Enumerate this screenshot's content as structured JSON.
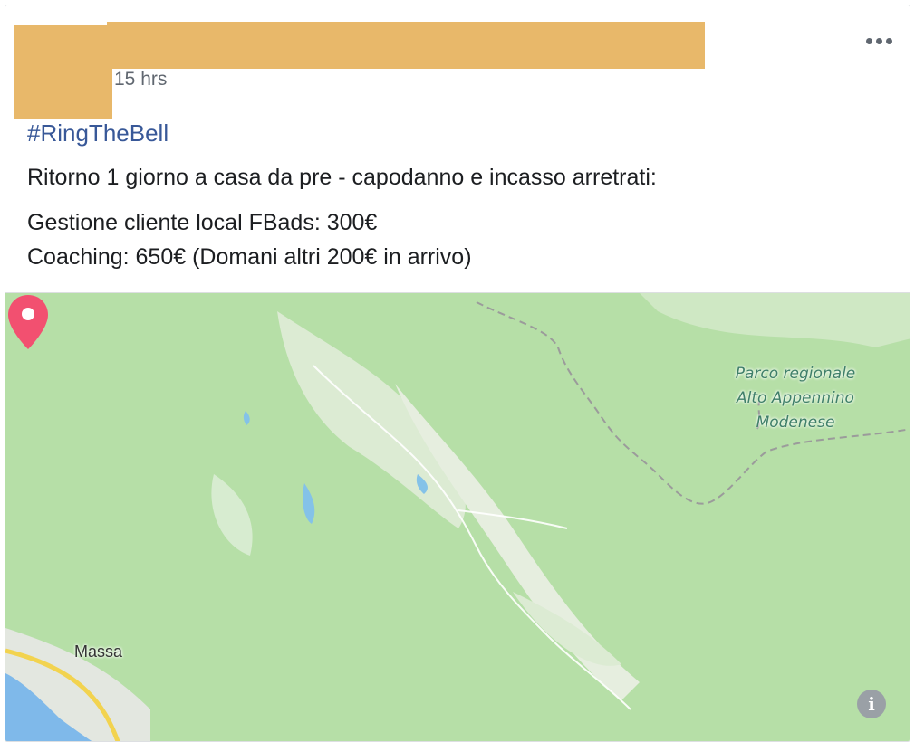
{
  "post": {
    "timestamp": "15 hrs",
    "hashtag": "#RingTheBell",
    "text_line1": "Ritorno 1 giorno a casa da pre - capodanno e incasso arretrati:",
    "text_line2": "Gestione cliente local FBads: 300€",
    "text_line3": "Coaching: 650€ (Domani altri 200€ in arrivo)"
  },
  "map": {
    "park_label": "Parco regionale Alto Appennino Modenese",
    "city_label": "Massa",
    "info_glyph": "i",
    "pin_color": "#f25070",
    "icons": [
      "map-pin-icon",
      "info-icon",
      "more-options-icon"
    ]
  }
}
